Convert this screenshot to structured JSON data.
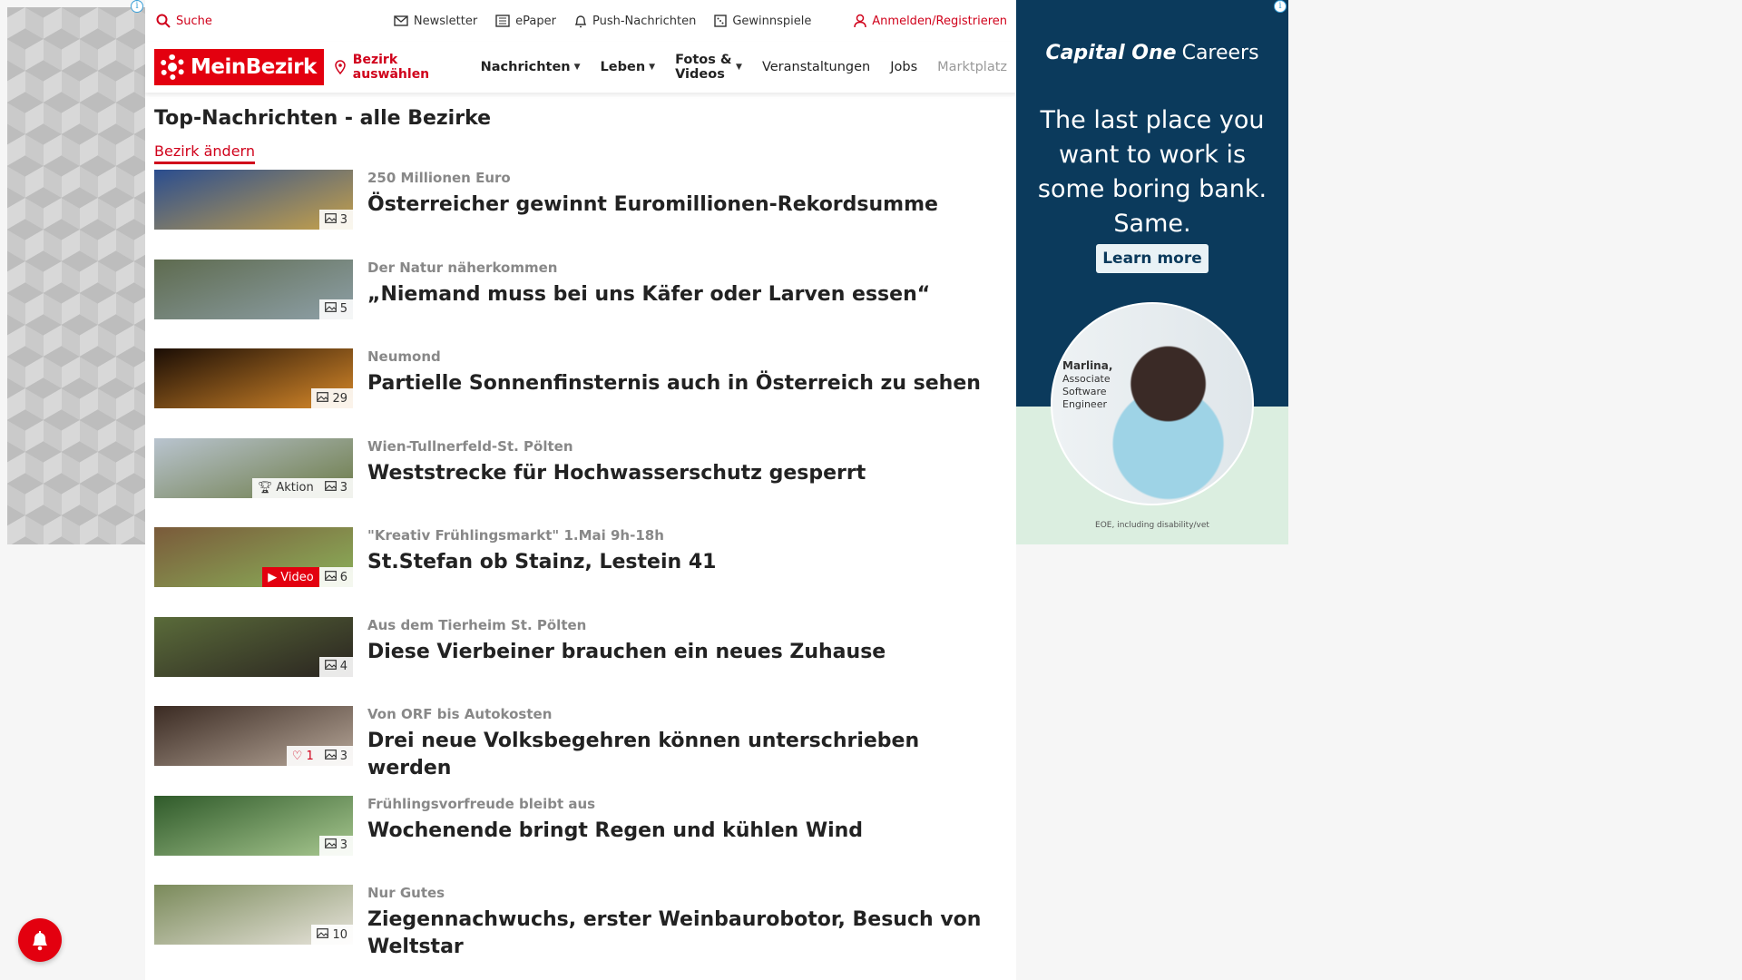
{
  "topbar": {
    "search": "Suche",
    "newsletter": "Newsletter",
    "epaper": "ePaper",
    "push": "Push-Nachrichten",
    "contests": "Gewinnspiele",
    "login": "Anmelden/Registrieren"
  },
  "nav": {
    "logo": "MeinBezirk",
    "district": "Bezirk auswählen",
    "items": [
      "Nachrichten",
      "Leben",
      "Fotos & Videos",
      "Veranstaltungen",
      "Jobs",
      "Marktplatz"
    ]
  },
  "section": {
    "title": "Top-Nachrichten - alle Bezirke",
    "change": "Bezirk ändern"
  },
  "articles": [
    {
      "kicker": "250 Millionen Euro",
      "headline": "Österreicher gewinnt Euromillionen-Rekordsumme",
      "photos": "3",
      "thumb": [
        "#2a4d8f",
        "#c7a24a"
      ]
    },
    {
      "kicker": "Der Natur näherkommen",
      "headline": "„Niemand muss bei uns Käfer oder Larven essen“",
      "photos": "5",
      "thumb": [
        "#5e6b4f",
        "#8ea0a8"
      ]
    },
    {
      "kicker": "Neumond",
      "headline": "Partielle Sonnenfinsternis auch in Österreich zu sehen",
      "photos": "29",
      "thumb": [
        "#1a0d05",
        "#d98a2a"
      ]
    },
    {
      "kicker": "Wien-Tullnerfeld-St. Pölten",
      "headline": "Weststrecke für Hochwasserschutz gesperrt",
      "photos": "3",
      "action": "Aktion",
      "thumb": [
        "#b9c4cf",
        "#6b7a45"
      ]
    },
    {
      "kicker": "\"Kreativ Frühlingsmarkt\" 1.Mai 9h-18h",
      "headline": "St.Stefan ob Stainz, Lestein 41",
      "photos": "6",
      "video": "Video",
      "thumb": [
        "#7a5a3a",
        "#8bb25a"
      ]
    },
    {
      "kicker": "Aus dem Tierheim St. Pölten",
      "headline": "Diese Vierbeiner brauchen ein neues Zuhause",
      "photos": "4",
      "thumb": [
        "#5a6b3a",
        "#2a2420"
      ]
    },
    {
      "kicker": "Von ORF bis Autokosten",
      "headline": "Drei neue Volksbegehren können unterschrieben werden",
      "photos": "3",
      "likes": "1",
      "thumb": [
        "#3a2a22",
        "#b8a89a"
      ]
    },
    {
      "kicker": "Frühlingsvorfreude bleibt aus",
      "headline": "Wochenende bringt Regen und kühlen Wind",
      "photos": "3",
      "thumb": [
        "#2f5a2a",
        "#a8c890"
      ]
    },
    {
      "kicker": "Nur Gutes",
      "headline": "Ziegennachwuchs, erster Weinbaurobotor, Besuch von Weltstar",
      "photos": "10",
      "thumb": [
        "#7a8a5a",
        "#e8e4dc"
      ]
    }
  ],
  "ad": {
    "brand_bold": "Capital One",
    "brand_rest": "Careers",
    "tagline": "The last place you want to work is some boring bank. Same.",
    "cta": "Learn more",
    "person_name": "Marlina,",
    "person_role_1": "Associate",
    "person_role_2": "Software",
    "person_role_3": "Engineer",
    "fine_print": "EOE, including disability/vet"
  },
  "colors": {
    "brand_red": "#e3000f",
    "ad_navy": "#0b3a5c"
  }
}
